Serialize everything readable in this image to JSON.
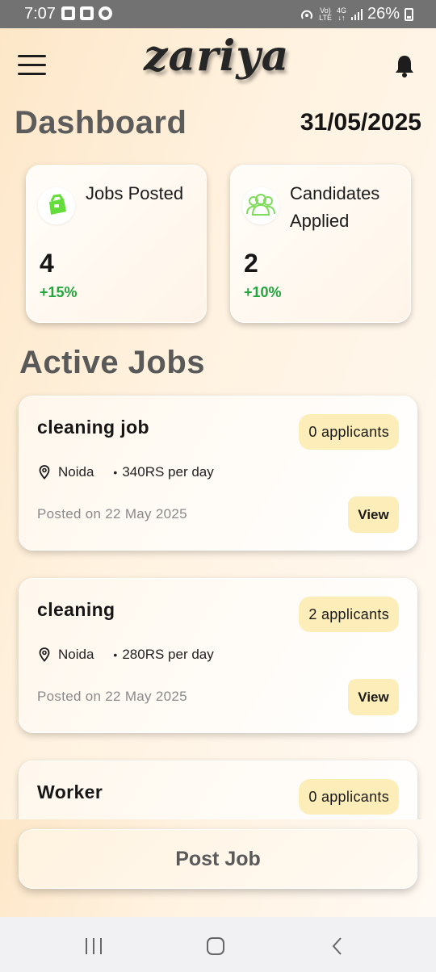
{
  "status_bar": {
    "time": "7:07",
    "network_top": "Vo)",
    "network_bottom": "LTE",
    "data_top": "4G",
    "data_bottom": "↓↑",
    "battery": "26%"
  },
  "header": {
    "logo": "zariya",
    "menu_icon": "hamburger-menu-icon",
    "bell_icon": "bell-icon"
  },
  "dashboard": {
    "title": "Dashboard",
    "date": "31/05/2025"
  },
  "stats": [
    {
      "label": "Jobs Posted",
      "value": "4",
      "change": "+15%",
      "icon": "briefcase-icon",
      "accent": "#5fd83a"
    },
    {
      "label": "Candidates Applied",
      "value": "2",
      "change": "+10%",
      "icon": "people-icon",
      "accent": "#5fd83a"
    }
  ],
  "active_jobs": {
    "title": "Active Jobs",
    "jobs": [
      {
        "title": "cleaning job",
        "applicants": "0 applicants",
        "location": "Noida",
        "pay": "340RS per day",
        "posted": "Posted on 22 May 2025",
        "view_label": "View"
      },
      {
        "title": "cleaning",
        "applicants": "2 applicants",
        "location": "Noida",
        "pay": "280RS per day",
        "posted": "Posted on 22 May 2025",
        "view_label": "View"
      },
      {
        "title": "Worker",
        "applicants": "0 applicants"
      }
    ]
  },
  "post_job_label": "Post Job",
  "colors": {
    "positive": "#22a63c",
    "badge": "#fdedb9",
    "title_gray": "#5c5c5c"
  }
}
